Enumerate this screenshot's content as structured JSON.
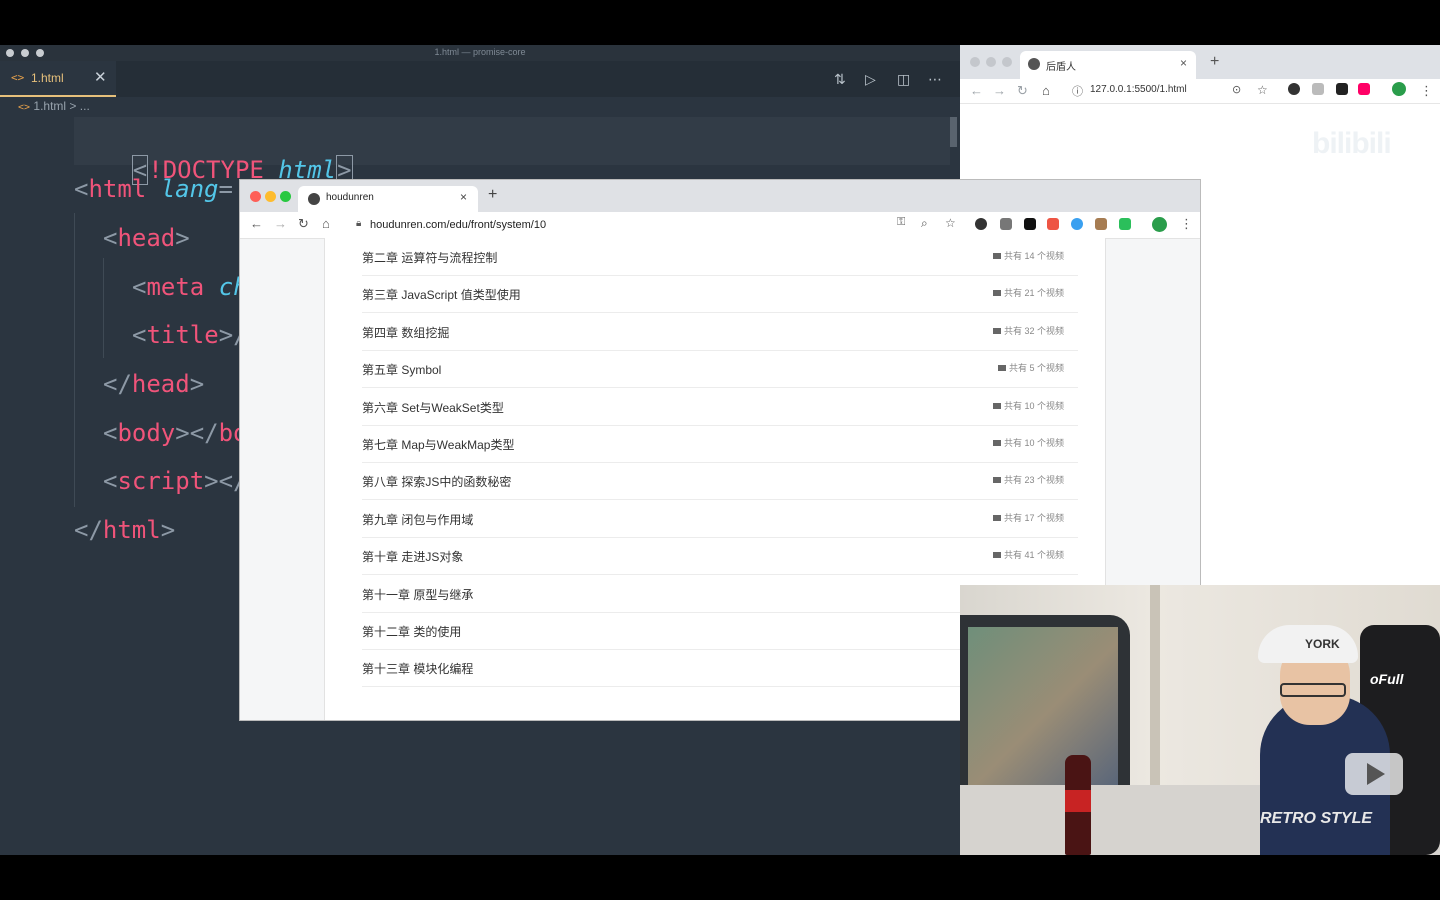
{
  "editor": {
    "window_title": "1.html — promise-core",
    "tab": {
      "icon": "<>",
      "label": "1.html",
      "close": "✕"
    },
    "toolbar_icons": [
      "git-compare-icon",
      "run-icon",
      "split-editor-icon",
      "more-icon"
    ],
    "breadcrumb": {
      "icon": "<>",
      "file": "1.html",
      "sep": ">",
      "rest": "..."
    },
    "code_lines": [
      "<!DOCTYPE html>",
      "<html lang=",
      "<head>",
      "<meta ch",
      "<title>/",
      "</head>",
      "<body></bo",
      "<script></",
      "</html>"
    ]
  },
  "right_browser": {
    "tab_title": "后盾人",
    "tab_close": "×",
    "new_tab": "+",
    "url": "127.0.0.1:5500/1.html",
    "watermark": "bilibili"
  },
  "center_browser": {
    "tab_title": "houdunren",
    "tab_close": "×",
    "new_tab": "+",
    "url": "houdunren.com/edu/front/system/10",
    "chapters": [
      {
        "title": "第二章 运算符与流程控制",
        "count": "共有 14 个视频"
      },
      {
        "title": "第三章 JavaScript 值类型使用",
        "count": "共有 21 个视频"
      },
      {
        "title": "第四章 数组挖掘",
        "count": "共有 32 个视频"
      },
      {
        "title": "第五章 Symbol",
        "count": "共有 5 个视频"
      },
      {
        "title": "第六章 Set与WeakSet类型",
        "count": "共有 10 个视频"
      },
      {
        "title": "第七章 Map与WeakMap类型",
        "count": "共有 10 个视频"
      },
      {
        "title": "第八章 探索JS中的函数秘密",
        "count": "共有 23 个视频"
      },
      {
        "title": "第九章 闭包与作用域",
        "count": "共有 17 个视频"
      },
      {
        "title": "第十章 走进JS对象",
        "count": "共有 41 个视频"
      },
      {
        "title": "第十一章 原型与继承",
        "count": ""
      },
      {
        "title": "第十二章 类的使用",
        "count": ""
      },
      {
        "title": "第十三章 模块化编程",
        "count": ""
      }
    ]
  },
  "webcam": {
    "cap_text": "YORK",
    "chair_text": "oFull",
    "shirt_text": "RETRO STYLE"
  },
  "colors": {
    "editor_bg": "#2b3540",
    "tag": "#f0547a",
    "attr": "#53c6e8",
    "tab_accent": "#e6c07b"
  }
}
